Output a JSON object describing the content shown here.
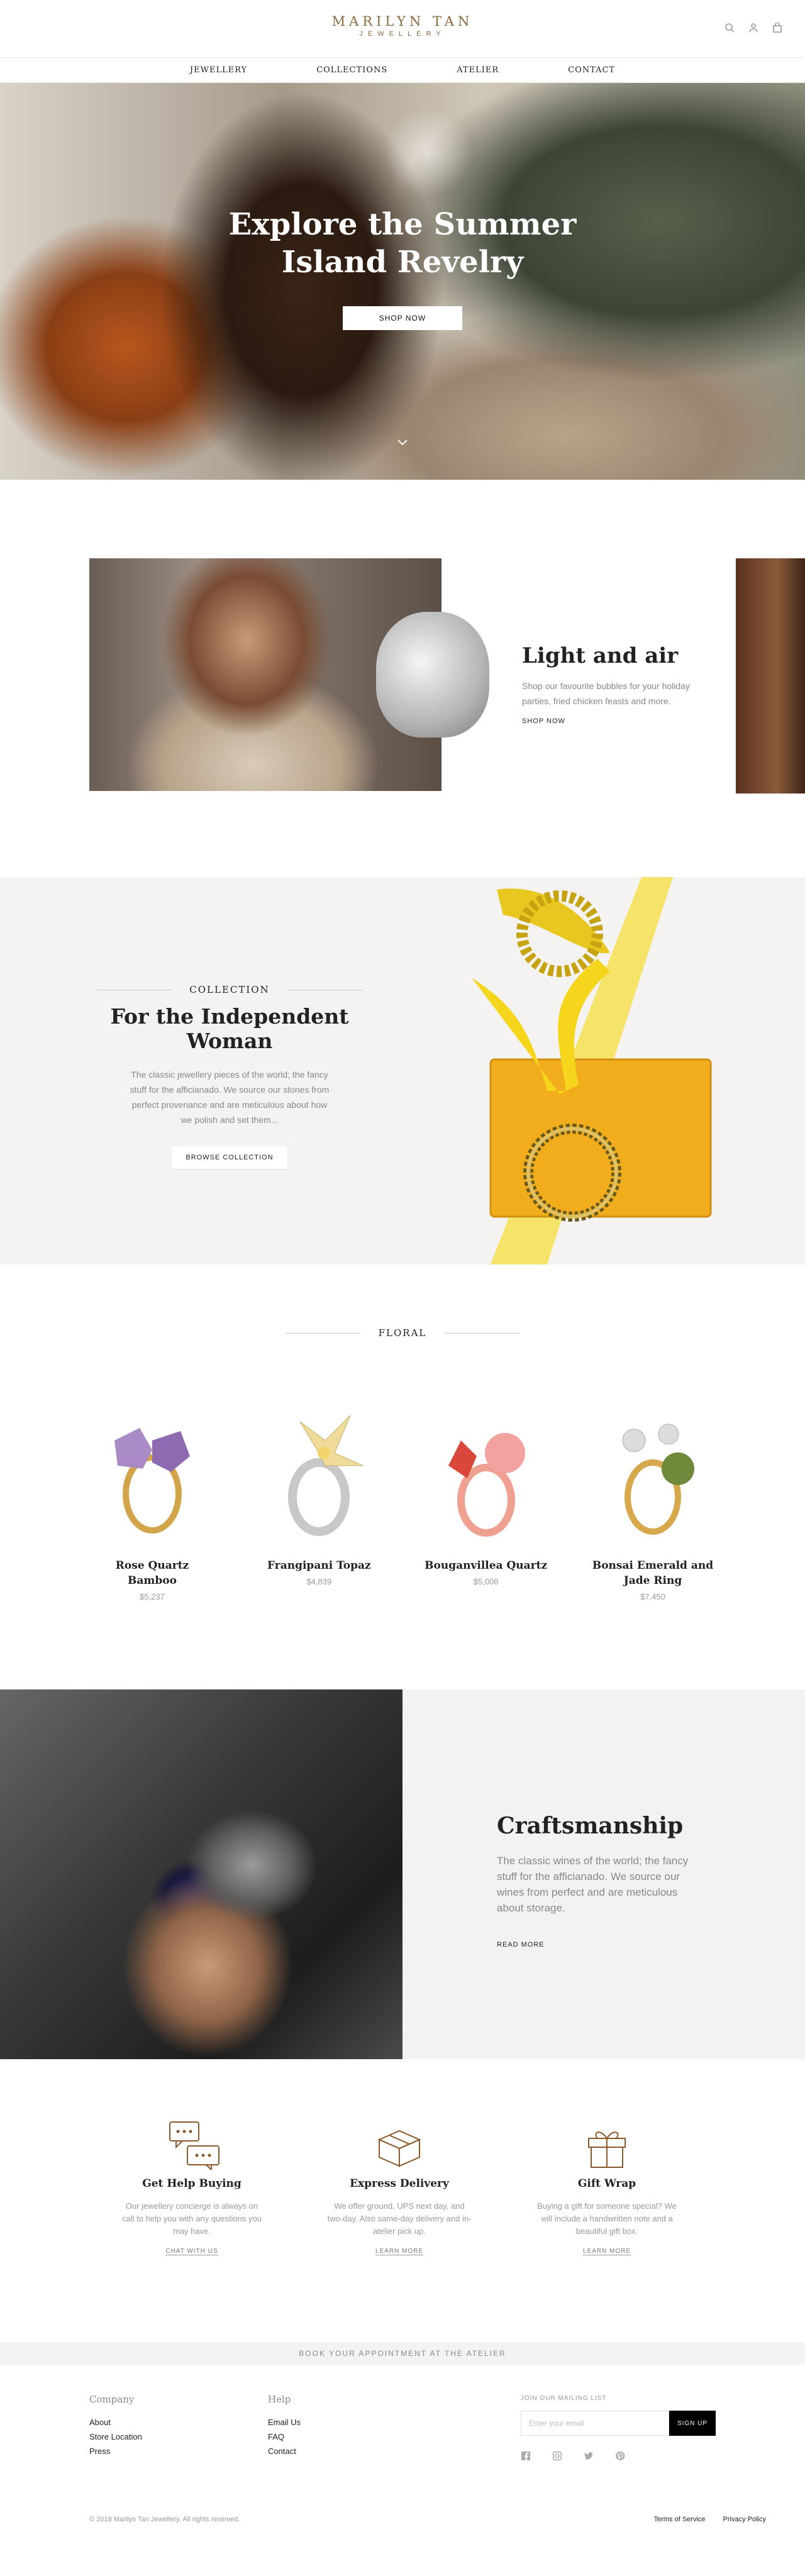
{
  "brand": {
    "line1": "MARILYN TAN",
    "line2": "JEWELLERY"
  },
  "header_icons": [
    "search-icon",
    "user-icon",
    "bag-icon"
  ],
  "nav": [
    "JEWELLERY",
    "COLLECTIONS",
    "ATELIER",
    "CONTACT"
  ],
  "hero": {
    "title_line1": "Explore the Summer",
    "title_line2": "Island Revelry",
    "button": "SHOP NOW"
  },
  "light": {
    "title": "Light and air",
    "text": "Shop our favourite bubbles for your holiday parties, fried chicken feasts and more.",
    "link": "SHOP NOW"
  },
  "collection": {
    "eyebrow": "COLLECTION",
    "title": "For the Independent Woman",
    "text": "The classic jewellery pieces of the world; the fancy stuff for the afficianado. We source our stones from perfect provenance and are meticulous about how we polish and set them...",
    "button": "BROWSE COLLECTION"
  },
  "floral": {
    "heading": "FLORAL",
    "products": [
      {
        "name": "Rose Quartz Bamboo",
        "price": "$5,237"
      },
      {
        "name": "Frangipani Topaz",
        "price": "$4,839"
      },
      {
        "name": "Bouganvillea Quartz",
        "price": "$5,008"
      },
      {
        "name": "Bonsai Emerald and Jade Ring",
        "price": "$7,450"
      }
    ]
  },
  "craft": {
    "title": "Craftsmanship",
    "text": "The classic wines of the world; the fancy stuff for the afficianado. We source our wines from perfect and are meticulous about storage.",
    "link": "READ MORE"
  },
  "services": [
    {
      "icon": "chat-bubbles-icon",
      "title": "Get Help Buying",
      "text": "Our jewellery concierge is always on call to help you with any questions you may have.",
      "link": "CHAT WITH US"
    },
    {
      "icon": "box-icon",
      "title": "Express Delivery",
      "text": "We offer ground, UPS next day, and two-day. Also same-day delivery and in- atelier pick up.",
      "link": "LEARN MORE"
    },
    {
      "icon": "gift-icon",
      "title": "Gift Wrap",
      "text": "Buying a gift for someone special? We will include a handwritten note and a beautiful gift box.",
      "link": "LEARN MORE"
    }
  ],
  "appointment": "BOOK YOUR APPOINTMENT AT THE ATELIER",
  "footer": {
    "company": {
      "heading": "Company",
      "links": [
        "About",
        "Store Location",
        "Press"
      ]
    },
    "help": {
      "heading": "Help",
      "links": [
        "Email Us",
        "FAQ",
        "Contact"
      ]
    },
    "mailing": {
      "label": "JOIN OUR MAILING LIST",
      "placeholder": "Enter your email",
      "button": "SIGN UP"
    },
    "social": [
      "facebook-icon",
      "instagram-icon",
      "twitter-icon",
      "pinterest-icon"
    ],
    "copyright": "© 2018 Marilyn Tan Jewellery. All rights reserved.",
    "legal": [
      "Terms of Service",
      "Privacy Policy"
    ]
  },
  "colors": {
    "brand_gold": "#8b6a3e",
    "icon_brown": "#8a5a2b",
    "light_bg": "#f4f3f1"
  }
}
